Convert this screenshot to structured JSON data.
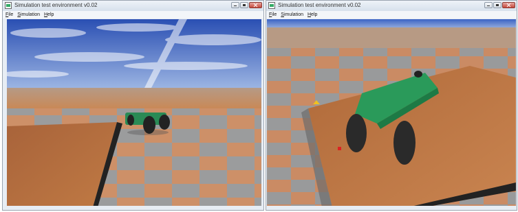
{
  "windows": [
    {
      "title": "Simulation test environment v0.02",
      "menu": [
        {
          "accel": "F",
          "rest": "ile"
        },
        {
          "accel": "S",
          "rest": "imulation"
        },
        {
          "accel": "H",
          "rest": "elp"
        }
      ]
    },
    {
      "title": "Simulation test environment v0.02",
      "menu": [
        {
          "accel": "F",
          "rest": "ile"
        },
        {
          "accel": "S",
          "rest": "imulation"
        },
        {
          "accel": "H",
          "rest": "elp"
        }
      ]
    }
  ],
  "colors": {
    "sky_top": "#2a4fb3",
    "sky_bottom": "#8fa9dc",
    "tile_orange": "#c97a4c",
    "tile_gray": "#8f8f8f",
    "ramp_wood": "#b06a3a",
    "car_body": "#2a8a55"
  }
}
